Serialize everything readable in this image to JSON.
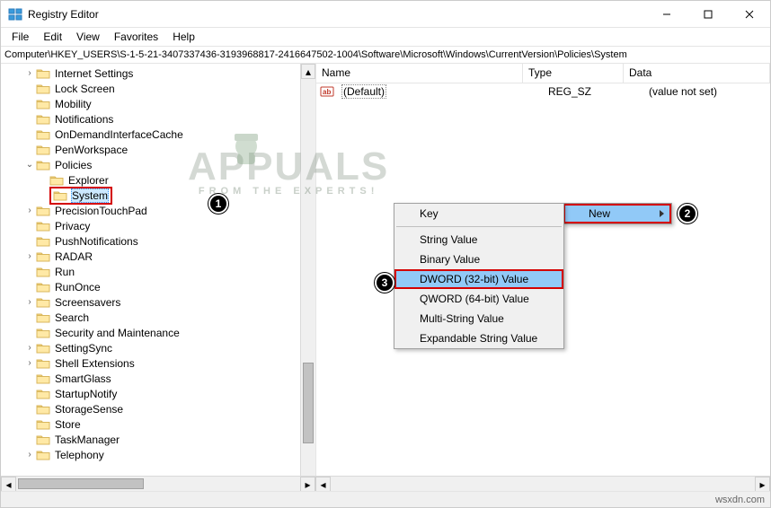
{
  "window": {
    "title": "Registry Editor"
  },
  "menus": [
    "File",
    "Edit",
    "View",
    "Favorites",
    "Help"
  ],
  "path": "Computer\\HKEY_USERS\\S-1-5-21-3407337436-3193968817-2416647502-1004\\Software\\Microsoft\\Windows\\CurrentVersion\\Policies\\System",
  "tree": {
    "items": [
      {
        "label": "Internet Settings",
        "depth": 7,
        "exp": ">"
      },
      {
        "label": "Lock Screen",
        "depth": 7,
        "exp": ""
      },
      {
        "label": "Mobility",
        "depth": 7,
        "exp": ""
      },
      {
        "label": "Notifications",
        "depth": 7,
        "exp": ""
      },
      {
        "label": "OnDemandInterfaceCache",
        "depth": 7,
        "exp": ""
      },
      {
        "label": "PenWorkspace",
        "depth": 7,
        "exp": ""
      },
      {
        "label": "Policies",
        "depth": 7,
        "exp": "v"
      },
      {
        "label": "Explorer",
        "depth": 8,
        "exp": ""
      },
      {
        "label": "System",
        "depth": 8,
        "exp": "",
        "selected": true,
        "highlight": true
      },
      {
        "label": "PrecisionTouchPad",
        "depth": 7,
        "exp": ">"
      },
      {
        "label": "Privacy",
        "depth": 7,
        "exp": ""
      },
      {
        "label": "PushNotifications",
        "depth": 7,
        "exp": ""
      },
      {
        "label": "RADAR",
        "depth": 7,
        "exp": ">"
      },
      {
        "label": "Run",
        "depth": 7,
        "exp": ""
      },
      {
        "label": "RunOnce",
        "depth": 7,
        "exp": ""
      },
      {
        "label": "Screensavers",
        "depth": 7,
        "exp": ">"
      },
      {
        "label": "Search",
        "depth": 7,
        "exp": ""
      },
      {
        "label": "Security and Maintenance",
        "depth": 7,
        "exp": ""
      },
      {
        "label": "SettingSync",
        "depth": 7,
        "exp": ">"
      },
      {
        "label": "Shell Extensions",
        "depth": 7,
        "exp": ">"
      },
      {
        "label": "SmartGlass",
        "depth": 7,
        "exp": ""
      },
      {
        "label": "StartupNotify",
        "depth": 7,
        "exp": ""
      },
      {
        "label": "StorageSense",
        "depth": 7,
        "exp": ""
      },
      {
        "label": "Store",
        "depth": 7,
        "exp": ""
      },
      {
        "label": "TaskManager",
        "depth": 7,
        "exp": ""
      },
      {
        "label": "Telephony",
        "depth": 7,
        "exp": ">"
      }
    ]
  },
  "list": {
    "columns": {
      "name": "Name",
      "type": "Type",
      "data": "Data"
    },
    "rows": [
      {
        "name": "(Default)",
        "type": "REG_SZ",
        "data": "(value not set)"
      }
    ]
  },
  "context_parent": {
    "items": [
      {
        "label": "New",
        "highlight": true,
        "hasSub": true,
        "red": true
      }
    ]
  },
  "context_sub": {
    "items": [
      {
        "label": "Key"
      },
      {
        "sep": true
      },
      {
        "label": "String Value"
      },
      {
        "label": "Binary Value"
      },
      {
        "label": "DWORD (32-bit) Value",
        "highlight": true,
        "red": true
      },
      {
        "label": "QWORD (64-bit) Value"
      },
      {
        "label": "Multi-String Value"
      },
      {
        "label": "Expandable String Value"
      }
    ]
  },
  "callouts": [
    "1",
    "2",
    "3"
  ],
  "statusbar": "wsxdn.com",
  "watermark": {
    "main": "APPUALS",
    "sub": "FROM THE EXPERTS!"
  }
}
